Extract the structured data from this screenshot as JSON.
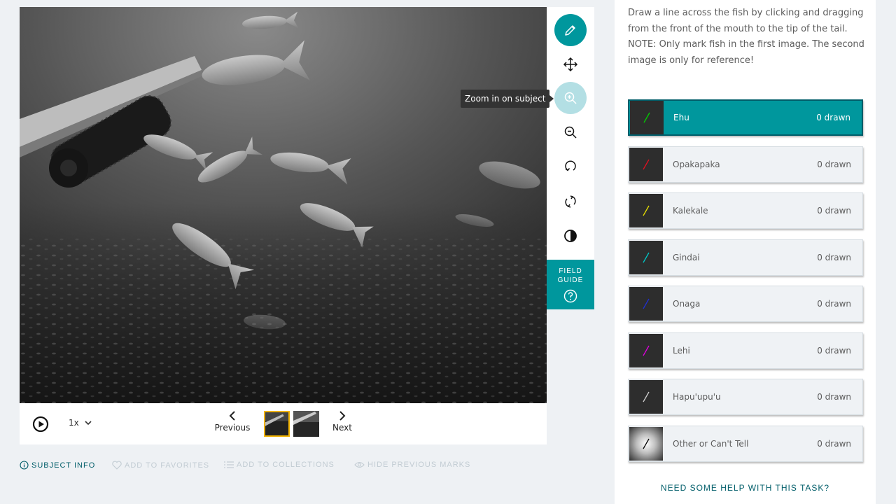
{
  "viewer": {
    "tooltip": "Zoom in on subject",
    "speed": "1x",
    "previous_label": "Previous",
    "next_label": "Next",
    "field_guide_label": "FIELD GUIDE"
  },
  "meta_links": {
    "subject_info": "SUBJECT INFO",
    "add_to_favorites": "ADD TO FAVORITES",
    "add_to_collections": "ADD TO COLLECTIONS",
    "hide_previous_marks": "HIDE PREVIOUS MARKS"
  },
  "task": {
    "instructions": [
      "Draw a line across the fish by clicking and dragging from the front of the mouth to the tip of the tail.",
      "NOTE: Only mark fish in the first image. The second image is only for reference!"
    ],
    "choices": [
      {
        "label": "Ehu",
        "count": "0 drawn",
        "color": "#00d000",
        "selected": true
      },
      {
        "label": "Opakapaka",
        "count": "0 drawn",
        "color": "#e01020",
        "selected": false
      },
      {
        "label": "Kalekale",
        "count": "0 drawn",
        "color": "#e8e000",
        "selected": false
      },
      {
        "label": "Gindai",
        "count": "0 drawn",
        "color": "#00c8c8",
        "selected": false
      },
      {
        "label": "Onaga",
        "count": "0 drawn",
        "color": "#2030d0",
        "selected": false
      },
      {
        "label": "Lehi",
        "count": "0 drawn",
        "color": "#e000e0",
        "selected": false
      },
      {
        "label": "Hapu'upu'u",
        "count": "0 drawn",
        "color": "#d0d0d0",
        "selected": false
      },
      {
        "label": "Other or Can't Tell",
        "count": "0 drawn",
        "color": "#000000",
        "selected": false
      }
    ],
    "help_link": "NEED SOME HELP WITH THIS TASK?"
  },
  "colors": {
    "accent": "#00979d",
    "accent_dark": "#005d69",
    "thumb_highlight": "#f0b200"
  },
  "icons": {
    "tools": [
      "pencil-icon",
      "move-icon",
      "zoom-in-icon",
      "zoom-out-icon",
      "rotate-icon",
      "flip-icon",
      "contrast-icon"
    ],
    "field_guide": "question-icon"
  }
}
